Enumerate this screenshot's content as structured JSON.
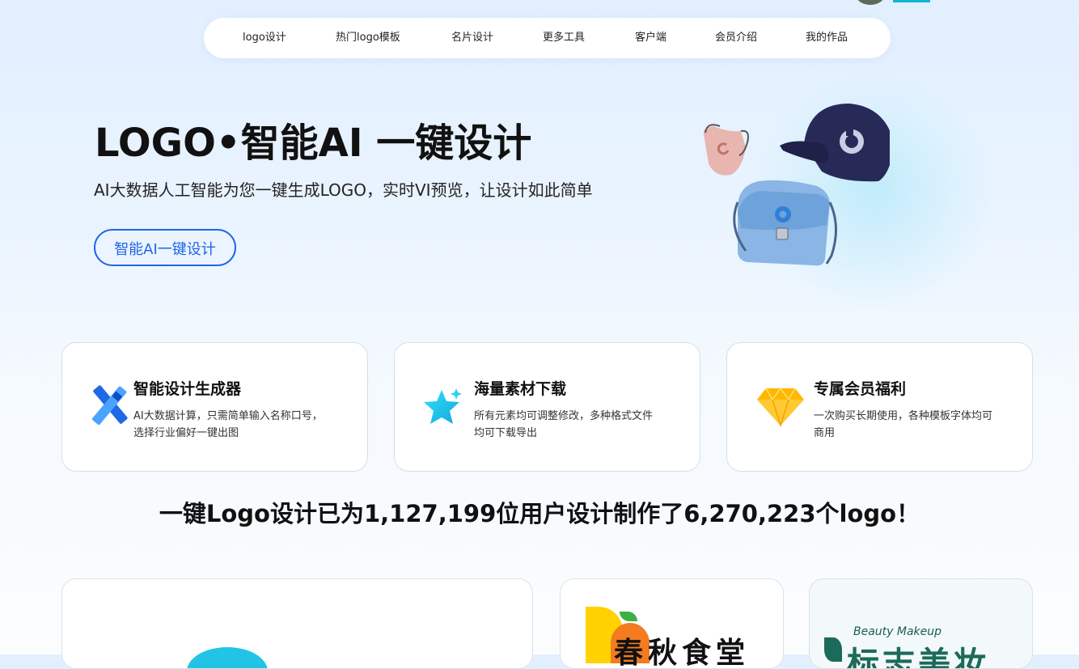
{
  "nav": {
    "items": [
      {
        "label": "logo设计"
      },
      {
        "label": "热门logo模板"
      },
      {
        "label": "名片设计"
      },
      {
        "label": "更多工具"
      },
      {
        "label": "客户端"
      },
      {
        "label": "会员介绍"
      },
      {
        "label": "我的作品"
      }
    ]
  },
  "hero": {
    "title": "LOGO•智能AI 一键设计",
    "subtitle": "AI大数据人工智能为您一键生成LOGO，实时VI预览，让设计如此简单",
    "button_label": "智能AI一键设计"
  },
  "features": [
    {
      "icon": "pen-ruler-icon",
      "title": "智能设计生成器",
      "line1": "AI大数据计算，只需简单输入名称口号，",
      "line2": "选择行业偏好一键出图"
    },
    {
      "icon": "star-icon",
      "title": "海量素材下载",
      "line1": "所有元素均可调整修改，多种格式文件",
      "line2": "均可下载导出"
    },
    {
      "icon": "diamond-icon",
      "title": "专属会员福利",
      "line1": "一次购买长期使用，各种模板字体均可",
      "line2": "商用"
    }
  ],
  "stats": {
    "text": "一键Logo设计已为1,127,199位用户设计制作了6,270,223个logo！"
  },
  "gallery": {
    "card2_text": "春秋食堂",
    "card3_script": "Beauty Makeup",
    "card3_text": "标志美妆"
  },
  "colors": {
    "accent": "#2165e8",
    "cyan": "#12b3d8"
  }
}
